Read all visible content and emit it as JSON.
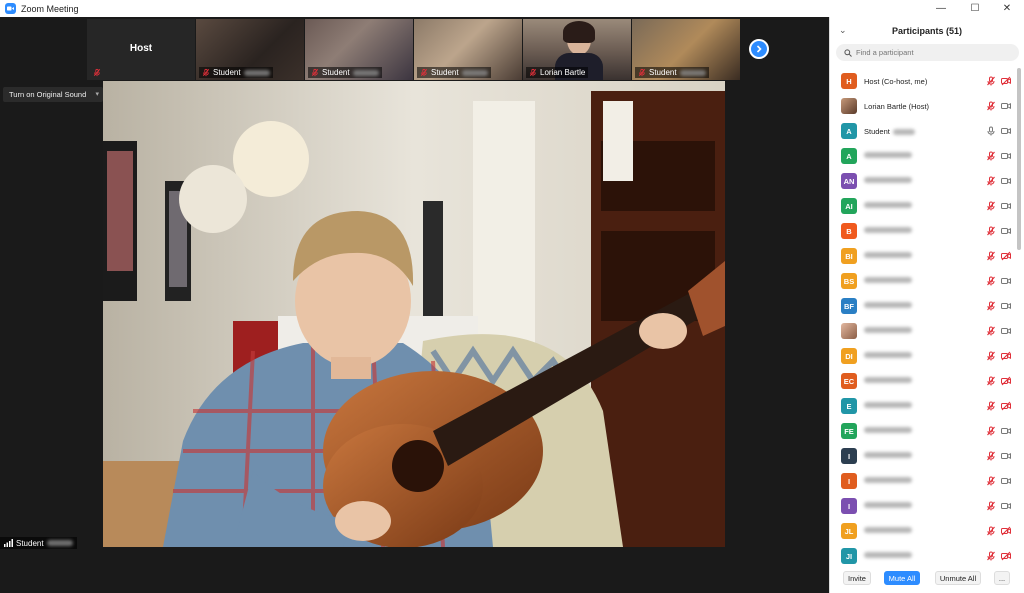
{
  "window": {
    "title": "Zoom Meeting",
    "controls": {
      "minimize": "—",
      "maximize": "☐",
      "close": "✕"
    }
  },
  "gallery_strip": {
    "tiles": [
      {
        "label": "Host",
        "type": "name-only",
        "muted": true
      },
      {
        "label": "Student",
        "type": "video",
        "muted": true,
        "scene": "piano"
      },
      {
        "label": "Student",
        "type": "video",
        "muted": true,
        "scene": "room"
      },
      {
        "label": "Student",
        "type": "video",
        "muted": true,
        "scene": "child"
      },
      {
        "label": "Lorian Bartle",
        "type": "video",
        "muted": true,
        "scene": "bookshelf"
      },
      {
        "label": "Student",
        "type": "video",
        "muted": true,
        "scene": "guitarist"
      }
    ],
    "next_icon": "chevron-right-icon"
  },
  "audio": {
    "original_sound_label": "Turn on Original Sound"
  },
  "active_speaker": {
    "label": "Student"
  },
  "participants": {
    "title": "Participants (51)",
    "search_placeholder": "Find a participant",
    "list": [
      {
        "initials": "H",
        "color": "#e05d1f",
        "name": "Host (Co-host, me)",
        "blurred": false,
        "mic": "muted",
        "video": "off"
      },
      {
        "initials": "",
        "color": "",
        "photo": true,
        "name": "Lorian Bartle (Host)",
        "blurred": false,
        "mic": "muted",
        "video": "on"
      },
      {
        "initials": "A",
        "color": "#2196a7",
        "name": "Student",
        "blurred": false,
        "tail_blurred": true,
        "mic": "on",
        "video": "on"
      },
      {
        "initials": "A",
        "color": "#22a55b",
        "name": "",
        "blurred": true,
        "mic": "muted",
        "video": "on"
      },
      {
        "initials": "AN",
        "color": "#7b4fb0",
        "name": "",
        "blurred": true,
        "mic": "muted",
        "video": "on"
      },
      {
        "initials": "AI",
        "color": "#22a55b",
        "name": "",
        "blurred": true,
        "mic": "muted",
        "video": "on"
      },
      {
        "initials": "B",
        "color": "#f05a1e",
        "name": "",
        "blurred": true,
        "mic": "muted",
        "video": "on"
      },
      {
        "initials": "BI",
        "color": "#f0a020",
        "name": "",
        "blurred": true,
        "mic": "muted",
        "video": "off"
      },
      {
        "initials": "BS",
        "color": "#f0a020",
        "name": "",
        "blurred": true,
        "mic": "muted",
        "video": "on"
      },
      {
        "initials": "BF",
        "color": "#2a7fc4",
        "name": "",
        "blurred": true,
        "mic": "muted",
        "video": "on"
      },
      {
        "initials": "",
        "color": "",
        "photo": true,
        "name": "",
        "blurred": true,
        "mic": "muted",
        "video": "on"
      },
      {
        "initials": "DI",
        "color": "#f0a020",
        "name": "",
        "blurred": true,
        "mic": "muted",
        "video": "off"
      },
      {
        "initials": "EC",
        "color": "#e05d1f",
        "name": "",
        "blurred": true,
        "mic": "muted",
        "video": "off"
      },
      {
        "initials": "E",
        "color": "#2196a7",
        "name": "",
        "blurred": true,
        "mic": "muted",
        "video": "off"
      },
      {
        "initials": "FE",
        "color": "#22a55b",
        "name": "",
        "blurred": true,
        "mic": "muted",
        "video": "on"
      },
      {
        "initials": "I",
        "color": "#2c3e50",
        "name": "",
        "blurred": true,
        "mic": "muted",
        "video": "on"
      },
      {
        "initials": "I",
        "color": "#e05d1f",
        "name": "",
        "blurred": true,
        "mic": "muted",
        "video": "on"
      },
      {
        "initials": "I",
        "color": "#7b4fb0",
        "name": "",
        "blurred": true,
        "mic": "muted",
        "video": "on"
      },
      {
        "initials": "JL",
        "color": "#f0a020",
        "name": "",
        "blurred": true,
        "mic": "muted",
        "video": "off"
      },
      {
        "initials": "JI",
        "color": "#2196a7",
        "name": "",
        "blurred": true,
        "mic": "muted",
        "video": "off"
      }
    ],
    "footer": {
      "invite": "Invite",
      "mute_all": "Mute All",
      "unmute_all": "Unmute All",
      "more": "..."
    }
  },
  "colors": {
    "accent": "#2d8cff",
    "muted_red": "#e0303a",
    "meeting_bg": "#1a1a1a"
  }
}
